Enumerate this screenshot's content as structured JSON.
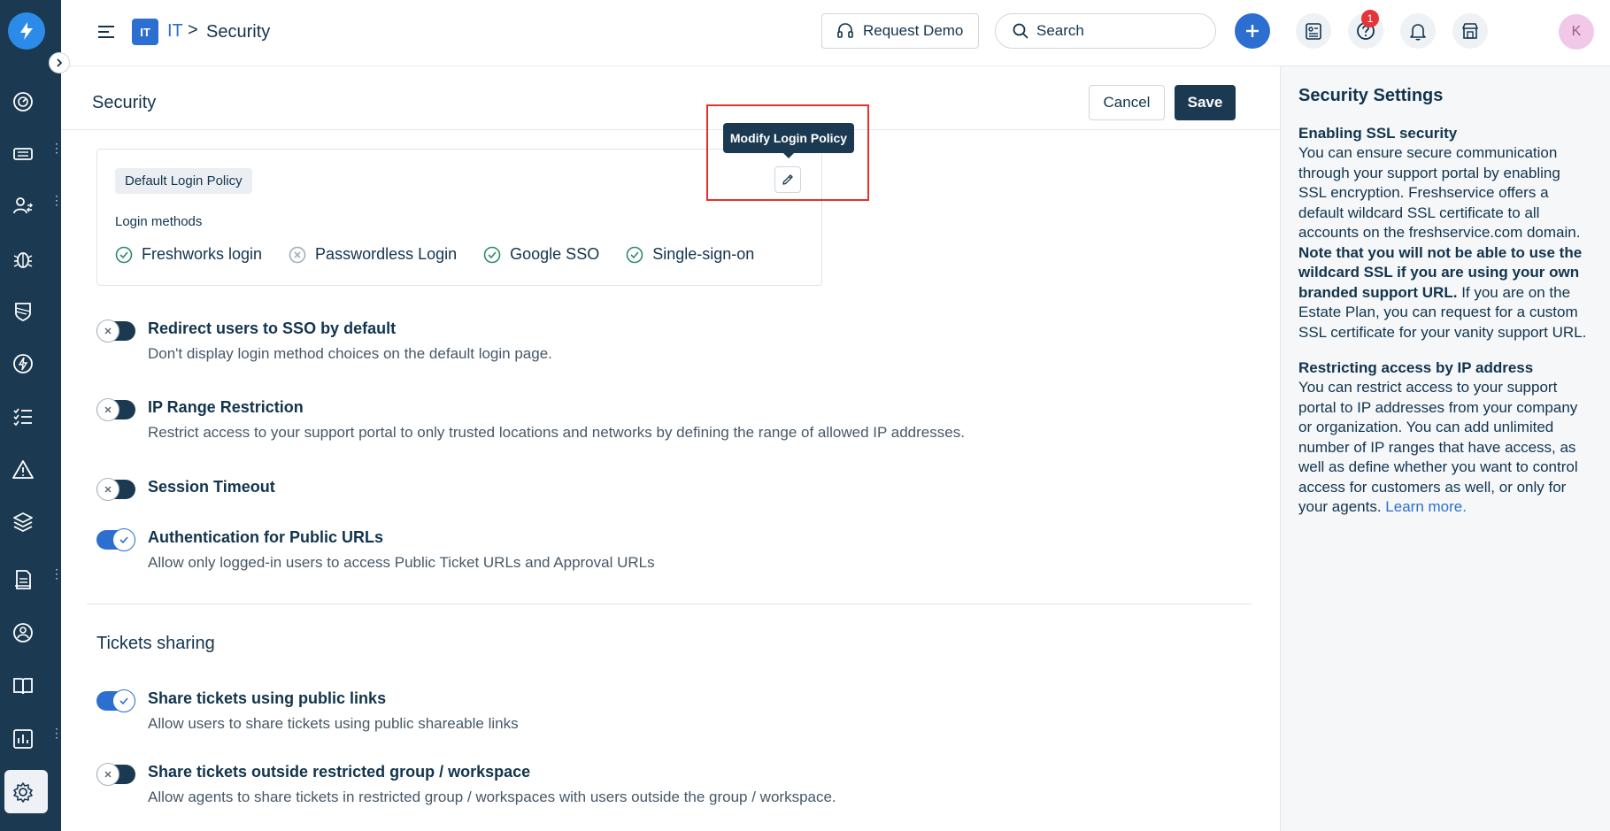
{
  "topbar": {
    "workspace_badge": "IT",
    "breadcrumb_workspace": "IT",
    "breadcrumb_separator": ">",
    "breadcrumb_page": "Security",
    "request_demo_label": "Request Demo",
    "search_placeholder": "Search",
    "notification_count": "1",
    "avatar_initial": "K"
  },
  "page": {
    "title": "Security",
    "cancel_label": "Cancel",
    "save_label": "Save"
  },
  "login_policy": {
    "tag": "Default Login Policy",
    "methods_label": "Login methods",
    "tooltip": "Modify Login Policy",
    "methods": [
      {
        "label": "Freshworks login",
        "enabled": true
      },
      {
        "label": "Passwordless Login",
        "enabled": false
      },
      {
        "label": "Google SSO",
        "enabled": true
      },
      {
        "label": "Single-sign-on",
        "enabled": true
      }
    ]
  },
  "settings": [
    {
      "title": "Redirect users to SSO by default",
      "desc": "Don't display login method choices on the default login page.",
      "on": false
    },
    {
      "title": "IP Range Restriction",
      "desc": "Restrict access to your support portal to only trusted locations and networks by defining the range of allowed IP addresses.",
      "on": false
    },
    {
      "title": "Session Timeout",
      "desc": "",
      "on": false
    },
    {
      "title": "Authentication for Public URLs",
      "desc": "Allow only logged-in users to access Public Ticket URLs and Approval URLs",
      "on": true
    }
  ],
  "tickets_sharing": {
    "title": "Tickets sharing",
    "settings": [
      {
        "title": "Share tickets using public links",
        "desc": "Allow users to share tickets using public shareable links",
        "on": true
      },
      {
        "title": "Share tickets outside restricted group / workspace",
        "desc": "Allow agents to share tickets in restricted group / workspaces with users outside the group / workspace.",
        "on": false
      }
    ]
  },
  "right_panel": {
    "title": "Security Settings",
    "ssl_title": "Enabling SSL security",
    "ssl_text_1": "You can ensure secure communication through your support portal by enabling SSL encryption. Freshservice offers a default wildcard SSL certificate to all accounts on the freshservice.com domain.",
    "ssl_text_bold": "Note that you will not be able to use the wildcard SSL if you are using your own branded support URL.",
    "ssl_text_2": "If you are on the Estate Plan, you can request for a custom SSL certificate for your vanity support URL.",
    "ip_title": "Restricting access by IP address",
    "ip_text": "You can restrict access to your support portal to IP addresses from your company or organization. You can add unlimited number of IP ranges that have access, as well as define whether you want to control access for customers as well, or only for your agents.",
    "learn_more": "Learn more."
  },
  "nav_icons": [
    "dashboard-icon",
    "tickets-icon",
    "contacts-icon",
    "problems-icon",
    "changes-icon",
    "releases-icon",
    "tasks-icon",
    "alerts-icon",
    "assets-icon",
    "documents-icon",
    "support-icon",
    "solutions-icon",
    "reports-icon",
    "settings-icon"
  ],
  "colors": {
    "nav_bg": "#1b3a52",
    "accent": "#2c6fd1",
    "highlight": "#e8302c",
    "check_green": "#2f8a6b"
  }
}
